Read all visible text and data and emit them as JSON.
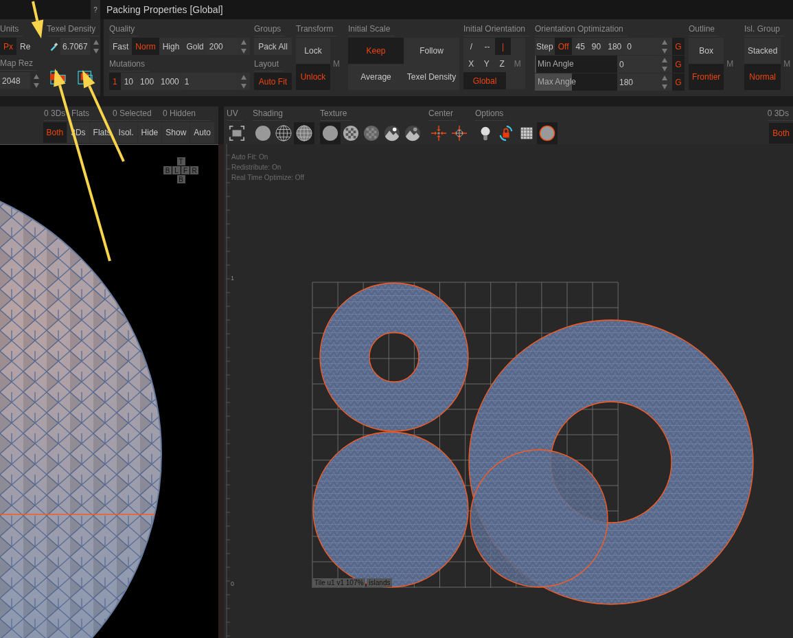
{
  "title_bar": {
    "help": "?",
    "title": "Packing Properties [Global]"
  },
  "left_props": {
    "units": {
      "label": "Units",
      "options": [
        {
          "label": "Px",
          "selected": true
        },
        {
          "label": "Re",
          "selected": false
        }
      ]
    },
    "texel_density": {
      "label": "Texel Density",
      "value": "6.7067"
    },
    "map_rez": {
      "label": "Map Rez",
      "value": "2048"
    }
  },
  "quality": {
    "label": "Quality",
    "options": [
      {
        "label": "Fast",
        "selected": false
      },
      {
        "label": "Norm",
        "selected": true
      },
      {
        "label": "High",
        "selected": false
      },
      {
        "label": "Gold",
        "selected": false
      }
    ],
    "value": "200"
  },
  "mutations": {
    "label": "Mutations",
    "options": [
      {
        "label": "1",
        "selected": true
      },
      {
        "label": "10",
        "selected": false
      },
      {
        "label": "100",
        "selected": false
      },
      {
        "label": "1000",
        "selected": false
      }
    ],
    "value": "1"
  },
  "groups": {
    "label": "Groups",
    "button": "Pack All"
  },
  "layout": {
    "label": "Layout",
    "button": "Auto Fit",
    "on": true
  },
  "transform": {
    "label": "Transform",
    "options": [
      {
        "label": "Lock",
        "selected": false
      },
      {
        "label": "Unlock",
        "selected": true
      }
    ],
    "mode": "M"
  },
  "initial_scale": {
    "label": "Initial Scale",
    "options": [
      {
        "label": "Keep",
        "selected": true
      },
      {
        "label": "Follow",
        "selected": false
      },
      {
        "label": "Average",
        "selected": false
      },
      {
        "label": "Texel Density",
        "selected": false
      }
    ]
  },
  "initial_orientation": {
    "label": "Initial Orientation",
    "directions": [
      {
        "label": "/",
        "selected": false
      },
      {
        "label": "--",
        "selected": false
      },
      {
        "label": "|",
        "selected": true
      }
    ],
    "axes": [
      "X",
      "Y",
      "Z"
    ],
    "mode": "M",
    "global": {
      "label": "Global",
      "on": true
    }
  },
  "orientation_optimization": {
    "label": "Orientation Optimization",
    "step": {
      "label": "Step",
      "options": [
        {
          "label": "Off",
          "selected": true
        },
        {
          "label": "45",
          "selected": false
        },
        {
          "label": "90",
          "selected": false
        },
        {
          "label": "180",
          "selected": false
        }
      ],
      "value": "0",
      "global": "G"
    },
    "sliders": [
      {
        "label": "Min Angle",
        "level": 0,
        "value": "0",
        "global": "G"
      },
      {
        "label": "Max Angle",
        "level": 0.45,
        "value": "180",
        "global": "G"
      }
    ]
  },
  "outline": {
    "label": "Outline",
    "options": [
      {
        "label": "Box",
        "selected": false
      },
      {
        "label": "Frontier",
        "selected": true
      }
    ],
    "mode": "M"
  },
  "island_group": {
    "label": "Isl. Group",
    "options": [
      {
        "label": "Stacked",
        "selected": false
      },
      {
        "label": "Normal",
        "selected": true
      }
    ],
    "mode": "M"
  },
  "view_filter": {
    "counts": [
      "0 3Ds",
      "Flats",
      "0 Selected",
      "0 Hidden"
    ],
    "buttons": [
      {
        "label": "Both",
        "selected": true
      },
      {
        "label": "3Ds",
        "selected": false
      },
      {
        "label": "Flats",
        "selected": false
      },
      {
        "label": "Isol.",
        "selected": false
      },
      {
        "label": "Hide",
        "selected": false
      },
      {
        "label": "Show",
        "selected": false
      },
      {
        "label": "Auto",
        "selected": false
      }
    ]
  },
  "uv_toolbar": {
    "sections": [
      {
        "label": "UV",
        "icons": [
          {
            "kind": "frame",
            "selected": false
          }
        ]
      },
      {
        "label": "Shading",
        "icons": [
          {
            "kind": "sphere",
            "selected": false
          },
          {
            "kind": "wire",
            "selected": false
          },
          {
            "kind": "wireshaded",
            "selected": true
          }
        ]
      },
      {
        "label": "Texture",
        "icons": [
          {
            "kind": "flat",
            "selected": true
          },
          {
            "kind": "checker",
            "selected": false
          },
          {
            "kind": "checkerdim",
            "selected": false
          },
          {
            "kind": "landscape",
            "selected": false
          },
          {
            "kind": "landscape2",
            "selected": false
          }
        ]
      },
      {
        "label": "Center",
        "icons": [
          {
            "kind": "center",
            "selected": false
          },
          {
            "kind": "centerglobe",
            "selected": false
          }
        ]
      },
      {
        "label": "Options",
        "icons": [
          {
            "kind": "bulb",
            "selected": false
          },
          {
            "kind": "locksync",
            "selected": false
          },
          {
            "kind": "grid",
            "selected": false
          },
          {
            "kind": "circle",
            "selected": true
          }
        ]
      }
    ],
    "count": "0 3Ds",
    "button": {
      "label": "Both",
      "selected": true
    }
  },
  "viewport": {
    "view_cube": {
      "top": "T",
      "middle": [
        "B",
        "L",
        "F",
        "R"
      ],
      "bottom": "B"
    }
  },
  "uv_canvas": {
    "status_lines": [
      "Auto Fit: On",
      "Redistribute: On",
      "Real Time Optimize: Off"
    ],
    "ruler": [
      "1",
      "0"
    ],
    "tile_label": {
      "tile": "Tile u1 v1 107%",
      "islands": "islands"
    }
  }
}
